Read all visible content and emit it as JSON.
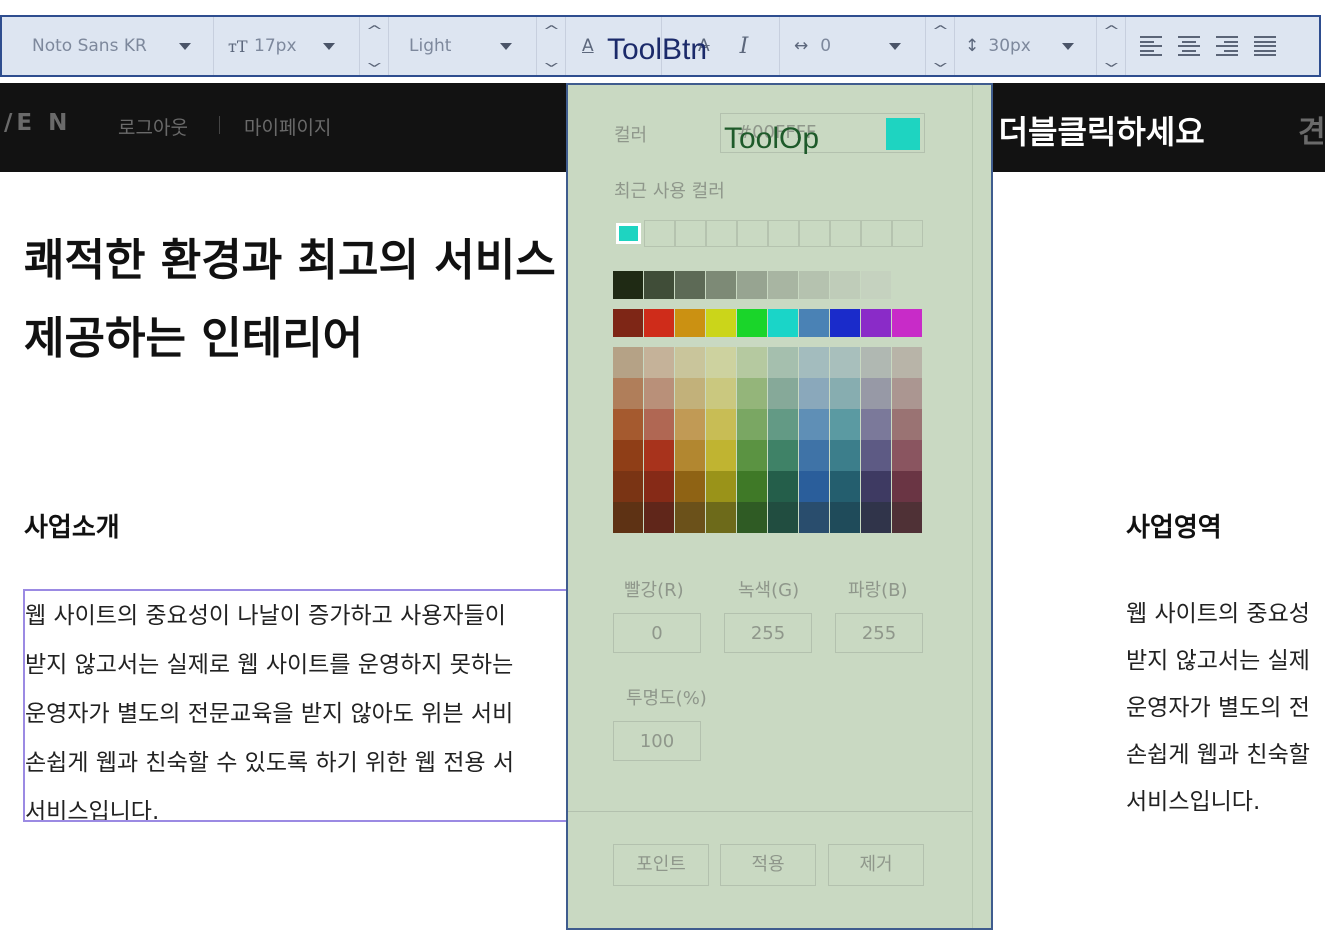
{
  "toolbar": {
    "font_family": "Noto Sans KR",
    "font_size": "17px",
    "font_weight": "Light",
    "letter_spacing": "0",
    "line_height": "30px",
    "overlay_label": "ToolBtn"
  },
  "header": {
    "brand": "/E N",
    "logout": "로그아웃",
    "mypage": "마이페이지",
    "cta": "면 더블클릭하세요",
    "right_text": "견"
  },
  "content": {
    "hero_line1": "쾌적한 환경과 최고의 서비스",
    "hero_line2": "제공하는 인테리어",
    "section_left": "사업소개",
    "section_right": "사업영역",
    "para_left": [
      "웹 사이트의 중요성이 나날이 증가하고 사용자들이",
      "받지 않고서는 실제로 웹 사이트를 운영하지 못하는",
      "운영자가 별도의 전문교육을 받지 않아도 위븐 서비",
      "손쉽게 웹과 친숙할 수 있도록 하기 위한 웹 전용 서",
      "서비스입니다."
    ],
    "para_right": [
      "웹 사이트의 중요성",
      "받지 않고서는 실제",
      "운영자가 별도의 전",
      "손쉽게 웹과 친숙할",
      "서비스입니다."
    ]
  },
  "picker": {
    "overlay_label": "ToolOp",
    "color_label": "컬러",
    "hex_value": "#00FFFF",
    "recent_label": "최근 사용 컬러",
    "r_label": "빨강(R)",
    "g_label": "녹색(G)",
    "b_label": "파랑(B)",
    "r_value": "0",
    "g_value": "255",
    "b_value": "255",
    "opacity_label": "투명도(%)",
    "opacity_value": "100",
    "btn_point": "포인트",
    "btn_apply": "적용",
    "btn_remove": "제거",
    "current_color": "#1ed4c1",
    "grays": [
      "#1f2a14",
      "#404d38",
      "#5d6a56",
      "#7d8a76",
      "#97a491",
      "#a8b5a2",
      "#b5c2af",
      "#bfccb9",
      "#c5d2bf",
      "#c9d9c2"
    ],
    "bright": [
      "#7e2616",
      "#cf2c1a",
      "#cb9112",
      "#cbd51a",
      "#1ad52a",
      "#1ad5c8",
      "#4a82b5",
      "#1a2bca",
      "#8a2bc8",
      "#c82bc8"
    ],
    "palette": [
      [
        "#b5a286",
        "#c5b299",
        "#c9c59b",
        "#cdd29f",
        "#b5c9a0",
        "#a5bfae",
        "#a3bcbe",
        "#a8bfbc",
        "#b0b8b2",
        "#b8b4a8"
      ],
      [
        "#b07e5a",
        "#b99079",
        "#c2b17a",
        "#cac87f",
        "#94b57a",
        "#86a999",
        "#8aa8bb",
        "#87adb0",
        "#9799a6",
        "#ab9691"
      ],
      [
        "#a55a2f",
        "#b06753",
        "#c19a55",
        "#c8bd55",
        "#7aa763",
        "#639a85",
        "#5f8fb6",
        "#5b9aa2",
        "#7b799a",
        "#9a7373"
      ],
      [
        "#8f3e17",
        "#a8331c",
        "#b28730",
        "#c0b431",
        "#5b9342",
        "#3f8267",
        "#3f73a7",
        "#3c7e8b",
        "#5d5a84",
        "#8a5560"
      ],
      [
        "#7a3414",
        "#862a17",
        "#8f6314",
        "#9a9319",
        "#3f7927",
        "#245e4a",
        "#2a5e9b",
        "#245e6e",
        "#3e3a62",
        "#6a3544"
      ],
      [
        "#5e3214",
        "#60261a",
        "#6b511a",
        "#6d6a1a",
        "#2f5b24",
        "#214d40",
        "#294d6d",
        "#1f4b5a",
        "#30344a",
        "#4f3136"
      ]
    ]
  }
}
